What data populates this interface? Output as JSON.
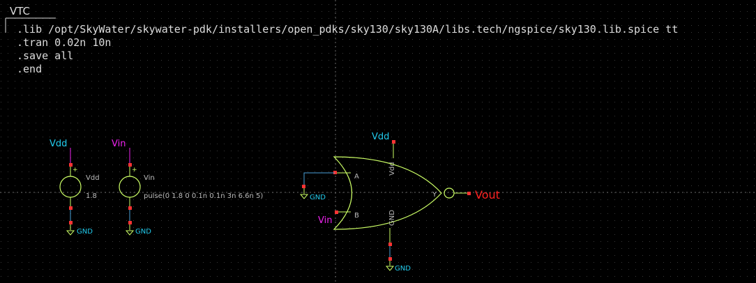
{
  "colors": {
    "background": "#000000",
    "grid_dot": "#3a3a3a",
    "axis": "#6a6a6a",
    "wire": "#4a9fd8",
    "component": "#ccff66",
    "pin": "#ff3333",
    "label_cyan": "#22ccee",
    "label_magenta": "#ee22ee",
    "label_red": "#ff2222",
    "text_white": "#dddddd",
    "text_gray": "#bbbbbb"
  },
  "code_block": {
    "title": "VTC",
    "lines": [
      ".lib /opt/SkyWater/skywater-pdk/installers/open_pdks/sky130/sky130A/libs.tech/ngspice/sky130.lib.spice tt",
      ".tran 0.02n 10n",
      ".save all",
      ".end"
    ]
  },
  "vdd_source": {
    "net_label": "Vdd",
    "name": "Vdd",
    "value": "1.8",
    "plus_sign": "+",
    "gnd_label": "GND"
  },
  "vin_source": {
    "net_label": "Vin",
    "name": "Vin",
    "value": "pulse(0 1.8 0 0.1n 0.1n 3n 6.6n 5)",
    "plus_sign": "+",
    "gnd_label": "GND"
  },
  "nor_gate": {
    "pin_a": "A",
    "pin_b": "B",
    "pin_y": "Y",
    "pin_vdd": "Vdd",
    "pin_gnd": "GND",
    "vdd_net_label": "Vdd",
    "gnd_label_a": "GND",
    "gnd_label_bottom": "GND",
    "input_b_net_label": "Vin",
    "output_net_label": "Vout"
  }
}
